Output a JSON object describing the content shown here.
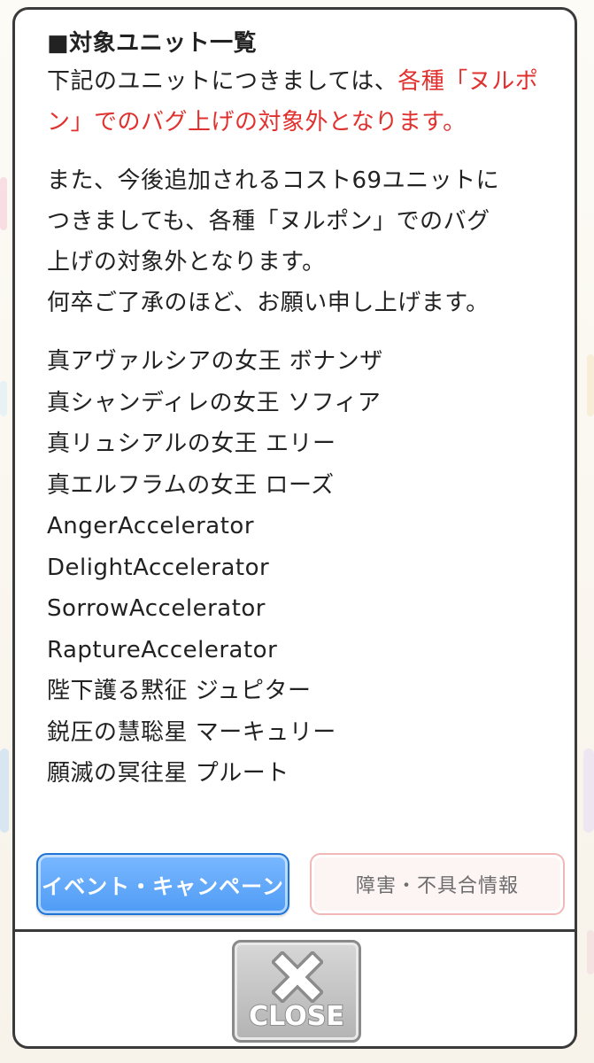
{
  "notice": {
    "heading": "■対象ユニット一覧",
    "para1_prefix": "下記のユニットにつきましては、",
    "para1_highlight": "各種「ヌルポン」でのバグ上げの対象外となります。",
    "para2_lines": [
      "また、今後追加されるコスト69ユニットに",
      "つきましても、各種「ヌルポン」でのバグ",
      "上げの対象外となります。",
      "何卒ご了承のほど、お願い申し上げます。"
    ],
    "units": [
      "真アヴァルシアの女王 ボナンザ",
      "真シャンディレの女王 ソフィア",
      "真リュシアルの女王 エリー",
      "真エルフラムの女王 ローズ",
      "AngerAccelerator",
      "DelightAccelerator",
      "SorrowAccelerator",
      "RaptureAccelerator",
      "陛下護る黙征 ジュピター",
      "鋭圧の慧聡星 マーキュリー",
      "願滅の冥往星 プルート"
    ]
  },
  "buttons": {
    "event_label": "イベント・キャンペーン",
    "fault_label": "障害・不具合情報",
    "close_label": "CLOSE"
  },
  "icons": {
    "close": "close-x-icon"
  },
  "colors": {
    "highlight": "#e0312f",
    "event_button": "#4f9cf5",
    "fault_button_border": "#f2b7b7",
    "close_button": "#b3b3b3"
  }
}
